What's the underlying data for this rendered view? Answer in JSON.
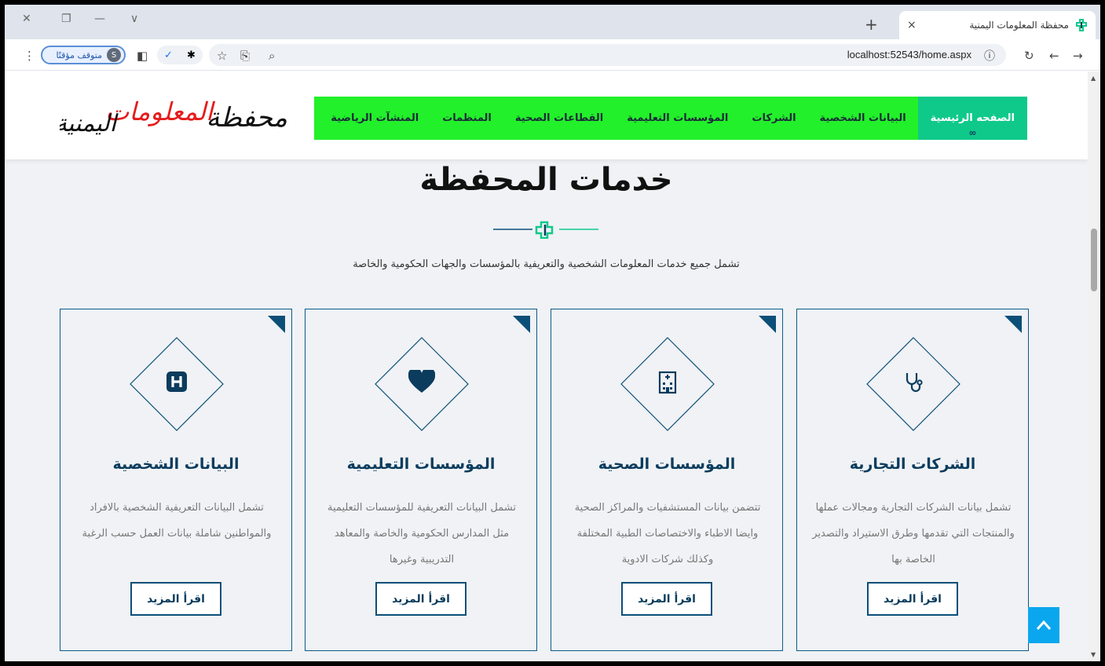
{
  "browser": {
    "tab_title": "محفظة المعلومات اليمنية",
    "tab_close": "×",
    "new_tab": "+",
    "url": "localhost:52543/home.aspx",
    "profile_status": "متوقف مؤقتًا",
    "profile_initial": "S",
    "window_controls": {
      "close": "✕",
      "restore": "❐",
      "minimize": "—",
      "tabs_menu": "∨"
    }
  },
  "header": {
    "logo_text_1": "محفظة",
    "logo_text_2": "المعلومات",
    "logo_text_3": "اليمنية",
    "nav": [
      {
        "label": "الصفحه الرئيسية",
        "active": true
      },
      {
        "label": "البيانات الشخصية"
      },
      {
        "label": "الشركات"
      },
      {
        "label": "المؤسسات التعليمية"
      },
      {
        "label": "القطاعات الصحية"
      },
      {
        "label": "المنظمات"
      },
      {
        "label": "المنشآت الرياضية"
      }
    ]
  },
  "section": {
    "title": "خدمات المحفظة",
    "subtitle": "تشمل جميع خدمات المعلومات الشخصية والتعريفية بالمؤسسات والجهات الحكومية والخاصة"
  },
  "cards": [
    {
      "title": "الشركات التجارية",
      "desc": "تشمل بيانات الشركات التجارية ومجالات عملها والمنتجات التي تقدمها وطرق الاستيراد والتصدير الخاصة بها",
      "button": "اقرأ المزيد",
      "icon": "stethoscope-icon"
    },
    {
      "title": "المؤسسات الصحية",
      "desc": "تتضمن بيانات المستشفيات والمراكز الصحية وايضا الاطباء والاختصاصات الطبية المختلفة وكذلك شركات الادوية",
      "button": "اقرأ المزيد",
      "icon": "hospital-building-icon"
    },
    {
      "title": "المؤسسات التعليمية",
      "desc": "تشمل البيانات التعريفية للمؤسسات التعليمية مثل المدارس الحكومية والخاصة والمعاهد التدريبية وغيرها",
      "button": "اقرأ المزيد",
      "icon": "heart-icon"
    },
    {
      "title": "البيانات الشخصية",
      "desc": "تشمل البيانات التعريفية الشخصية بالافراد والمواطنين شاملة بيانات العمل حسب الرغبة",
      "button": "اقرأ المزيد",
      "icon": "hospital-h-icon"
    }
  ],
  "colors": {
    "nav_bg": "#22f02a",
    "nav_active": "#0fc98a",
    "primary": "#0b3c5d",
    "back_to_top": "#0aa7ee"
  }
}
